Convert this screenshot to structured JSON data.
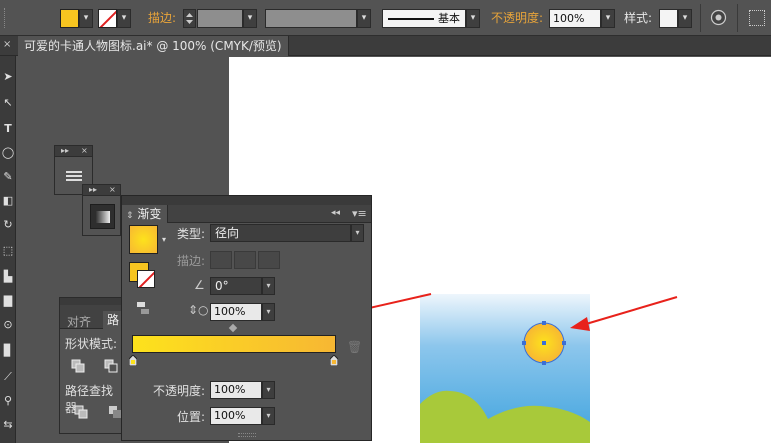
{
  "control_bar": {
    "stroke_label": "描边:",
    "stroke_style": "基本",
    "opacity_label": "不透明度:",
    "opacity_value": "100%",
    "style_label": "样式:"
  },
  "document": {
    "tab_title": "可爱的卡通人物图标.ai* @ 100% (CMYK/预览)"
  },
  "gradient_panel": {
    "tab_label": "渐变",
    "type_label": "类型:",
    "type_value": "径向",
    "stroke_label": "描边:",
    "angle_value": "0°",
    "aspect_value": "100%",
    "opacity_label": "不透明度:",
    "opacity_value": "100%",
    "location_label": "位置:",
    "location_value": "100%",
    "gradient_start": "#fde21c",
    "gradient_end": "#f7b733"
  },
  "side_panel": {
    "tab_align": "对齐",
    "tab_pathfinder": "路",
    "shape_modes_label": "形状模式:",
    "pathfinder_label": "路径查找器"
  },
  "colors": {
    "fill": "#f7c520",
    "sky_top": "#e8f3fb",
    "sky_bottom": "#3ea3de",
    "grass": "#a8c93a",
    "arrow": "#e8221b",
    "selection": "#3b6fd6"
  }
}
